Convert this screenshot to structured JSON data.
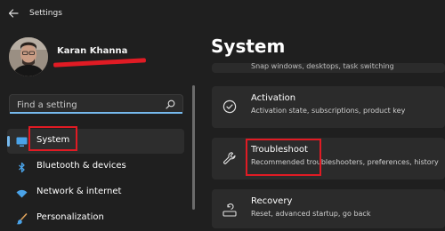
{
  "window": {
    "title": "Settings"
  },
  "user": {
    "name": "Karan Khanna"
  },
  "search": {
    "placeholder": "Find a setting"
  },
  "nav": [
    {
      "label": "System",
      "icon": "monitor-icon",
      "active": true
    },
    {
      "label": "Bluetooth & devices",
      "icon": "bluetooth-icon"
    },
    {
      "label": "Network & internet",
      "icon": "wifi-icon"
    },
    {
      "label": "Personalization",
      "icon": "brush-icon"
    }
  ],
  "page": {
    "title": "System"
  },
  "top_item": {
    "desc": "Snap windows, desktops, task switching"
  },
  "cards": [
    {
      "title": "Activation",
      "desc": "Activation state, subscriptions, product key",
      "icon": "check-circle-icon"
    },
    {
      "title": "Troubleshoot",
      "desc": "Recommended troubleshooters, preferences, history",
      "icon": "wrench-icon"
    },
    {
      "title": "Recovery",
      "desc": "Reset, advanced startup, go back",
      "icon": "recovery-drive-icon"
    }
  ],
  "colors": {
    "accent": "#76b9ed",
    "highlight": "#e01b24",
    "background": "#1f1f1f",
    "card": "#2b2b2b"
  }
}
